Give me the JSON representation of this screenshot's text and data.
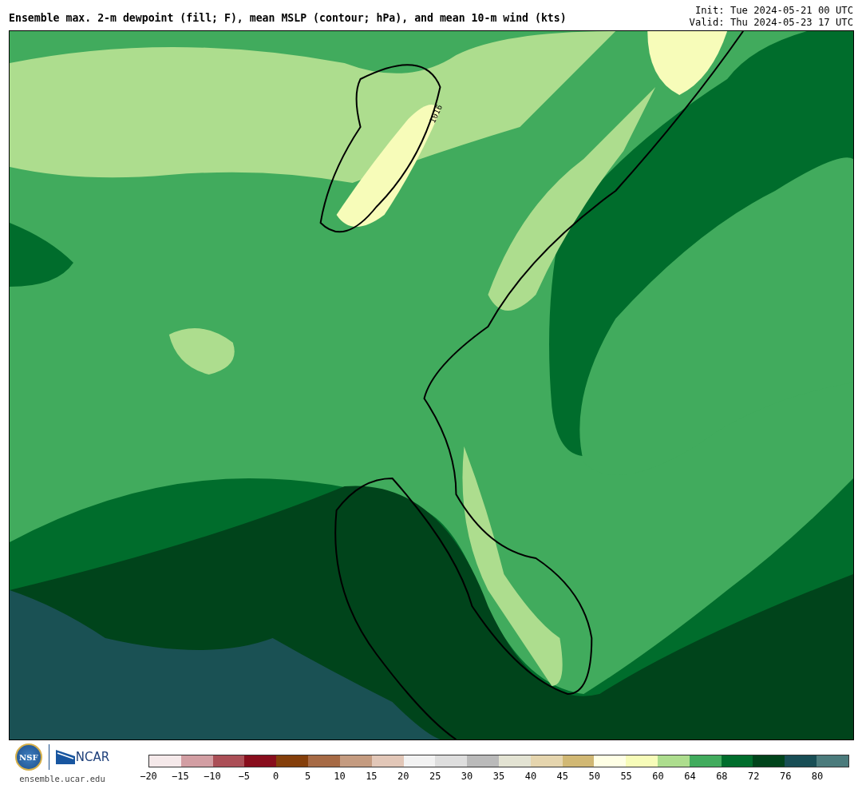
{
  "title": "Ensemble max. 2-m dewpoint (fill; F), mean MSLP (contour; hPa), and mean 10-m wind (kts)",
  "init": "Init: Tue 2024-05-21 00 UTC",
  "valid": "Valid: Thu 2024-05-23 17 UTC",
  "map": {
    "contour_label": "1016"
  },
  "logos": {
    "nsf": "NSF",
    "ncar": "NCAR",
    "url": "ensemble.ucar.edu"
  },
  "colorbar": {
    "segments": [
      {
        "color": "#f5e9ea"
      },
      {
        "color": "#d29ea3"
      },
      {
        "color": "#ab4f57"
      },
      {
        "color": "#880e1d"
      },
      {
        "color": "#843f0b"
      },
      {
        "color": "#a66a45"
      },
      {
        "color": "#c49b80"
      },
      {
        "color": "#e2c7b8"
      },
      {
        "color": "#f2f2f2"
      },
      {
        "color": "#dedede"
      },
      {
        "color": "#bababa"
      },
      {
        "color": "#e3e3d3"
      },
      {
        "color": "#e5d5ae"
      },
      {
        "color": "#d1b874"
      },
      {
        "color": "#ffffe5"
      },
      {
        "color": "#f7fcb9"
      },
      {
        "color": "#addd8e"
      },
      {
        "color": "#41ab5d"
      },
      {
        "color": "#006d2c"
      },
      {
        "color": "#00441b"
      },
      {
        "color": "#184e55"
      },
      {
        "color": "#4b7b7c"
      }
    ],
    "ticks": [
      "−20",
      "−15",
      "−10",
      "−5",
      "0",
      "5",
      "10",
      "15",
      "20",
      "25",
      "30",
      "35",
      "40",
      "45",
      "50",
      "55",
      "60",
      "64",
      "68",
      "72",
      "76",
      "80"
    ]
  }
}
